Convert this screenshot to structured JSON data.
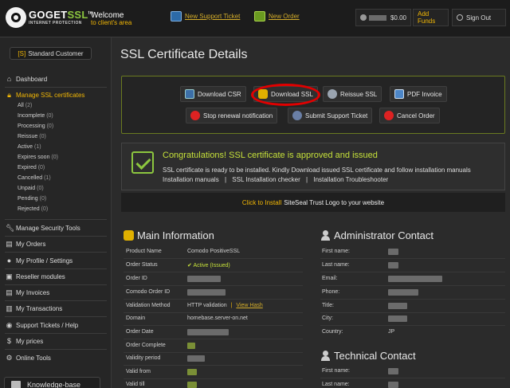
{
  "header": {
    "logo_main": "GOGET",
    "logo_accent": "SSL",
    "logo_tm": "tm",
    "logo_sub": "INTERNET PROTECTION",
    "welcome_line1": "Welcome",
    "welcome_line2": "to client's area",
    "new_ticket_label": "New Support Ticket",
    "new_order_label": "New Order",
    "balance": "$0.00",
    "add_funds_label": "Add Funds",
    "sign_out_label": "Sign Out"
  },
  "sidebar": {
    "customer_badge_prefix": "[S]",
    "customer_badge_label": "Standard Customer",
    "dashboard": "Dashboard",
    "manage_ssl": "Manage SSL certificates",
    "sub_items": [
      {
        "label": "All",
        "count": "(2)"
      },
      {
        "label": "Incomplete",
        "count": "(0)"
      },
      {
        "label": "Processing",
        "count": "(0)"
      },
      {
        "label": "Reissue",
        "count": "(0)"
      },
      {
        "label": "Active",
        "count": "(1)"
      },
      {
        "label": "Expires soon",
        "count": "(0)"
      },
      {
        "label": "Expired",
        "count": "(0)"
      },
      {
        "label": "Cancelled",
        "count": "(1)"
      },
      {
        "label": "Unpaid",
        "count": "(0)"
      },
      {
        "label": "Pending",
        "count": "(0)"
      },
      {
        "label": "Rejected",
        "count": "(0)"
      }
    ],
    "items": [
      "Manage Security Tools",
      "My Orders",
      "My Profile / Settings",
      "Reseller modules",
      "My Invoices",
      "My Transactions",
      "Support Tickets / Help",
      "My prices",
      "Online Tools"
    ],
    "knowledge_base": "Knowledge-base"
  },
  "main": {
    "title": "SSL Certificate Details",
    "actions": {
      "download_csr": "Download CSR",
      "download_ssl": "Download SSL",
      "reissue_ssl": "Reissue SSL",
      "pdf_invoice": "PDF Invoice",
      "stop_renewal": "Stop renewal notification",
      "submit_ticket": "Submit Support Ticket",
      "cancel_order": "Cancel Order"
    },
    "congrats": {
      "title": "Congratulations! SSL certificate is approved and issued",
      "text": "SSL certificate is ready to be installed. Kindly Download issued SSL certificate and follow installation manuals",
      "link1": "Installation manuals",
      "link2": "SSL Installation checker",
      "link3": "Installation Troubleshooter",
      "sep": "|"
    },
    "siteseal": {
      "link": "Click to Install",
      "text": "SiteSeal Trust Logo to your website"
    },
    "main_info": {
      "title": "Main Information",
      "rows": [
        {
          "label": "Product Name",
          "value": "Comodo PositiveSSL"
        },
        {
          "label": "Order Status",
          "value": "Active (Issued)"
        },
        {
          "label": "Order ID",
          "value": ""
        },
        {
          "label": "Comodo Order ID",
          "value": ""
        },
        {
          "label": "Validation Method",
          "value": "HTTP validation",
          "link": "View Hash"
        },
        {
          "label": "Domain",
          "value": "homebase.server-on.net"
        },
        {
          "label": "Order Date",
          "value": ""
        },
        {
          "label": "Order Complete",
          "value": ""
        },
        {
          "label": "Validity period",
          "value": ""
        },
        {
          "label": "Valid from",
          "value": ""
        },
        {
          "label": "Valid till",
          "value": ""
        }
      ]
    },
    "admin_contact": {
      "title": "Administrator Contact",
      "rows": [
        {
          "label": "First name:",
          "value": ""
        },
        {
          "label": "Last name:",
          "value": ""
        },
        {
          "label": "Email:",
          "value": ""
        },
        {
          "label": "Phone:",
          "value": ""
        },
        {
          "label": "Title:",
          "value": ""
        },
        {
          "label": "City:",
          "value": ""
        },
        {
          "label": "Country:",
          "value": "JP"
        }
      ]
    },
    "tech_contact": {
      "title": "Technical Contact",
      "rows": [
        {
          "label": "First name:",
          "value": ""
        },
        {
          "label": "Last name:",
          "value": ""
        }
      ]
    }
  },
  "colors": {
    "accent_green": "#c5e03a",
    "accent_yellow": "#f2b705",
    "highlight_ring": "#e20000"
  }
}
